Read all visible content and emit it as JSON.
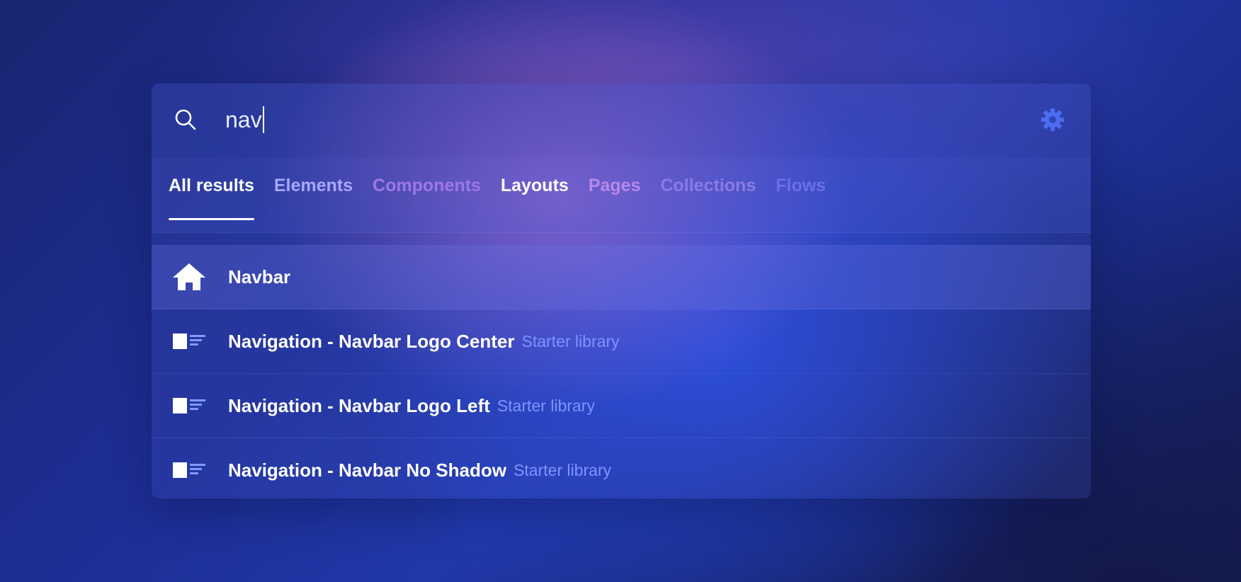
{
  "search": {
    "icon": "search-icon",
    "query": "nav",
    "settings_icon": "gear-icon"
  },
  "tabs": [
    {
      "label": "All results",
      "color": "#ffffff",
      "active": true
    },
    {
      "label": "Elements",
      "color": "#a9a7ff",
      "active": false
    },
    {
      "label": "Components",
      "color": "#9d78e6",
      "active": false
    },
    {
      "label": "Layouts",
      "color": "#ffffff",
      "active": false
    },
    {
      "label": "Pages",
      "color": "#b58ae8",
      "active": false
    },
    {
      "label": "Collections",
      "color": "#8a7be6",
      "active": false
    },
    {
      "label": "Flows",
      "color": "#6a6ee8",
      "active": false
    }
  ],
  "results": [
    {
      "icon": "home-icon",
      "title": "Navbar",
      "subtitle": "",
      "selected": true
    },
    {
      "icon": "layout-block-icon",
      "title": "Navigation - Navbar Logo Center",
      "subtitle": "Starter library",
      "selected": false
    },
    {
      "icon": "layout-block-icon",
      "title": "Navigation - Navbar Logo Left",
      "subtitle": "Starter library",
      "selected": false
    },
    {
      "icon": "layout-block-icon",
      "title": "Navigation - Navbar No Shadow",
      "subtitle": "Starter library",
      "selected": false
    }
  ],
  "colors": {
    "subtitle": "#7f93ff",
    "gear": "#4d6cf2",
    "icon_accent": "#7f9bff"
  }
}
